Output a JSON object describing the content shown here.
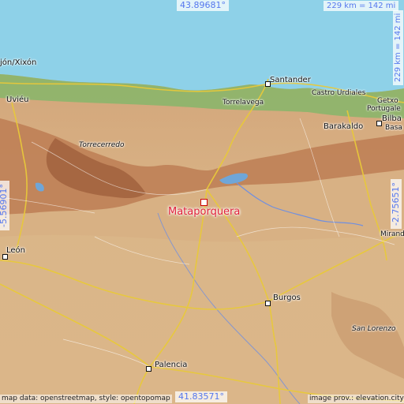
{
  "place": "Mataporquera",
  "coordinates": {
    "top": "43.89681°",
    "bottom": "41.83571°",
    "left": "-5.56901°",
    "right": "-2.75651°"
  },
  "scale": "229 km = 142 mi",
  "cities": [
    "Santander",
    "Torrelavega",
    "Castro Urdiales",
    "Getxo",
    "Portugalete",
    "Bilbao",
    "Barakaldo",
    "Basauri",
    "Uviéu",
    "Xixón",
    "León",
    "Burgos",
    "Palencia",
    "Miranda"
  ],
  "labels": {
    "xixon": "jón/Xixón",
    "uvieu": "Uviéu",
    "santander": "Santander",
    "torrelavega": "Torrelavega",
    "castro": "Castro Urdiales",
    "getxo": "Getxo",
    "portugale": "Portugale",
    "bilba": "Bilba",
    "barakaldo": "Barakaldo",
    "basa": "Basa",
    "torrecerredo": "Torrecerredo",
    "leon": "León",
    "burgos": "Burgos",
    "palencia": "Palencia",
    "miranda": "Miranda",
    "sanlorenzo": "San Lorenzo"
  },
  "credits": {
    "left": "map data: openstreetmap, style: opentopomap",
    "right": "image prov.: elevation.city"
  },
  "colors": {
    "sea": "#8ed1e8",
    "highlight": "#e0213a",
    "coord_text": "#5577ee"
  }
}
